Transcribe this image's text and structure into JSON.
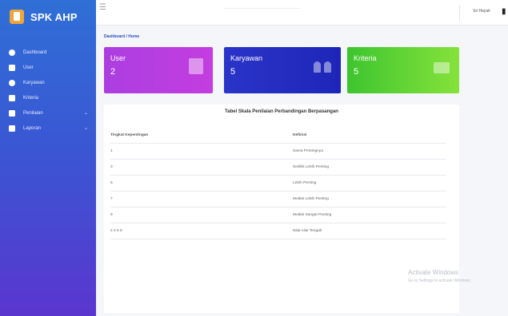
{
  "brand": {
    "name": "SPK AHP"
  },
  "sidebar": {
    "items": [
      {
        "label": "Dashboard",
        "icon": "dashboard-icon"
      },
      {
        "label": "User",
        "icon": "user-icon"
      },
      {
        "label": "Karyawan",
        "icon": "shield-icon"
      },
      {
        "label": "Kriteria",
        "icon": "document-icon"
      },
      {
        "label": "Penilaian",
        "icon": "table-icon",
        "has_submenu": true
      },
      {
        "label": "Laporan",
        "icon": "report-icon",
        "has_submenu": true
      }
    ]
  },
  "topbar": {
    "user_name": "Sri Hayati"
  },
  "breadcrumb": "Dashboard / Home",
  "cards": [
    {
      "label": "User",
      "value": "2",
      "icon": "id-badge-icon",
      "color": "#b33fe0"
    },
    {
      "label": "Karyawan",
      "value": "5",
      "icon": "users-icon",
      "color": "#242fc2"
    },
    {
      "label": "Kriteria",
      "value": "5",
      "icon": "envelope-icon",
      "color": "#5fd23a"
    }
  ],
  "table": {
    "title": "Tabel Skala Penilaian Perbandingan Berpasangan",
    "headers": [
      "Tingkat Kepentingan",
      "Definisi"
    ],
    "rows": [
      [
        "1",
        "Sama Pentingnya"
      ],
      [
        "3",
        "Sedikit Lebih Penting"
      ],
      [
        "5",
        "Lebih Penting"
      ],
      [
        "7",
        "Mutlak Lebih Penting"
      ],
      [
        "9",
        "Mutlak Sangat Penting"
      ],
      [
        "2 4 6 8",
        "Nilai-nilai Tengah"
      ]
    ]
  },
  "watermark": {
    "line1": "Activate Windows",
    "line2": "Go to Settings to activate Windows."
  }
}
